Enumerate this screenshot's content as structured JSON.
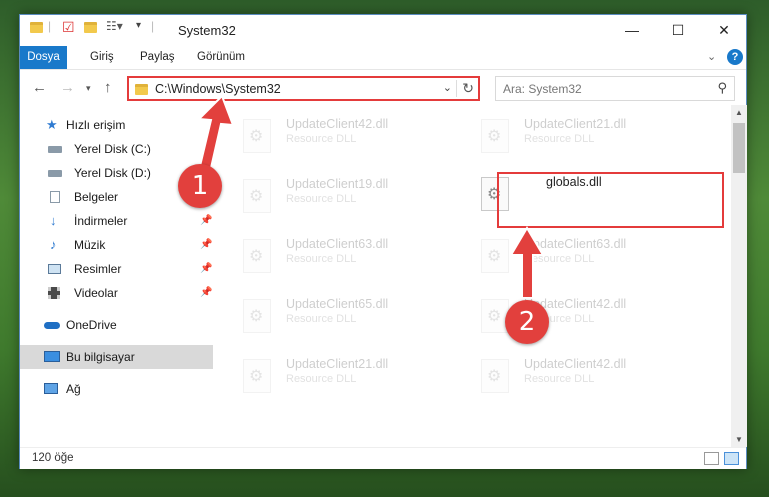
{
  "window": {
    "title": "System32",
    "buttons": {
      "minimize": "—",
      "maximize": "☐",
      "close": "✕"
    }
  },
  "ribbon": {
    "tabs": [
      "Dosya",
      "Giriş",
      "Paylaş",
      "Görünüm"
    ]
  },
  "nav": {
    "address": "C:\\Windows\\System32",
    "search_placeholder": "Ara: System32"
  },
  "sidebar": {
    "items": [
      {
        "label": "Hızlı erişim",
        "icon": "star-icon"
      },
      {
        "label": "Yerel Disk (C:)",
        "icon": "drive-icon"
      },
      {
        "label": "Yerel Disk (D:)",
        "icon": "drive-icon"
      },
      {
        "label": "Belgeler",
        "icon": "documents-icon"
      },
      {
        "label": "İndirmeler",
        "icon": "download-icon"
      },
      {
        "label": "Müzik",
        "icon": "music-icon"
      },
      {
        "label": "Resimler",
        "icon": "pictures-icon"
      },
      {
        "label": "Videolar",
        "icon": "videos-icon"
      },
      {
        "label": "OneDrive",
        "icon": "cloud-icon"
      },
      {
        "label": "Bu bilgisayar",
        "icon": "computer-icon"
      },
      {
        "label": "Ağ",
        "icon": "network-icon"
      }
    ]
  },
  "files": [
    {
      "name": "UpdateClient42.dll",
      "type": "Resource DLL"
    },
    {
      "name": "UpdateClient21.dll",
      "type": "Resource DLL"
    },
    {
      "name": "UpdateClient19.dll",
      "type": "Resource DLL"
    },
    {
      "name": "globals.dll",
      "type": ""
    },
    {
      "name": "UpdateClient63.dll",
      "type": "Resource DLL"
    },
    {
      "name": "UpdateClient63.dll",
      "type": "Resource DLL"
    },
    {
      "name": "UpdateClient65.dll",
      "type": "Resource DLL"
    },
    {
      "name": "UpdateClient42.dll",
      "type": "Resource DLL"
    },
    {
      "name": "UpdateClient21.dll",
      "type": "Resource DLL"
    },
    {
      "name": "UpdateClient42.dll",
      "type": "Resource DLL"
    }
  ],
  "status": {
    "count": "120 öğe"
  },
  "annotations": {
    "step1": "1",
    "step2": "2",
    "accent": "#e2403d"
  }
}
